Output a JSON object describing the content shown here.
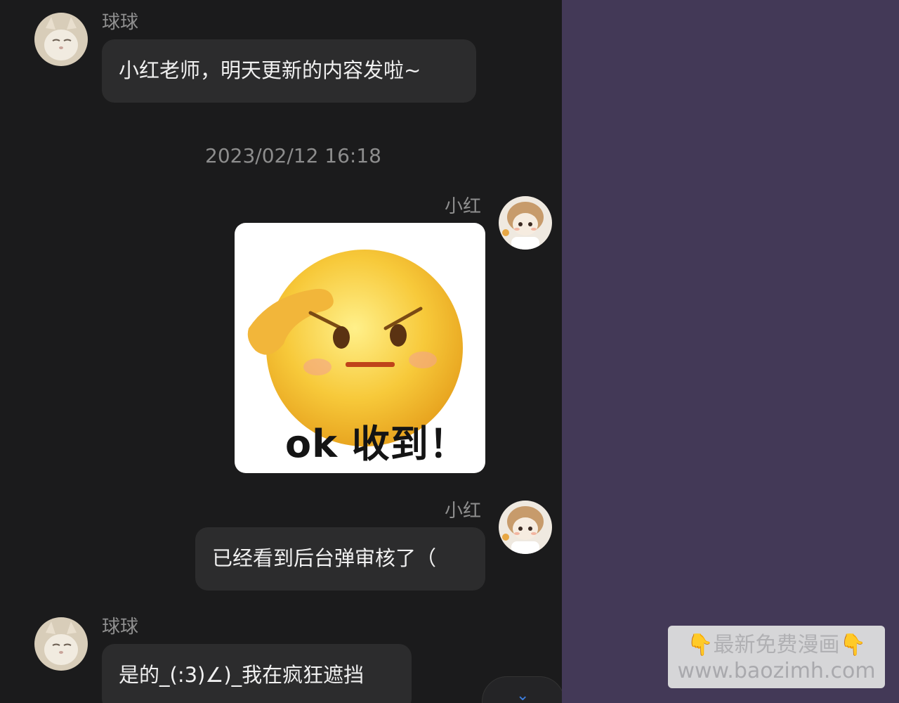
{
  "messages": [
    {
      "sender": "球球",
      "text": "小红老师，明天更新的内容发啦~"
    },
    {
      "timestamp": "2023/02/12 16:18"
    },
    {
      "sender": "小红",
      "sticker_caption": "ok 收到！"
    },
    {
      "sender": "小红",
      "text": "已经看到后台弹审核了（"
    },
    {
      "sender": "球球",
      "text": "是的_(:3)∠)_我在疯狂遮挡"
    }
  ],
  "scroll_button": {
    "icon": "chevron-down-icon",
    "glyph": "⌄"
  },
  "watermark": {
    "title": "最新免费漫画",
    "emoji": "👇",
    "url": "www.baozimh.com"
  },
  "colors": {
    "chat_bg": "#1b1b1c",
    "bubble": "#2c2c2d",
    "side_bg": "#433957"
  }
}
